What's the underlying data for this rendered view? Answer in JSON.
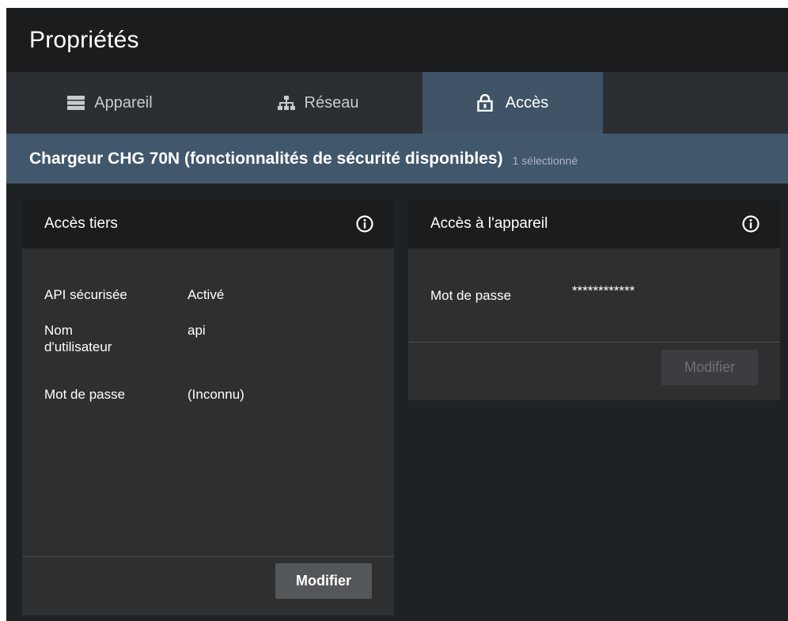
{
  "window": {
    "title": "Propriétés"
  },
  "tabs": [
    {
      "label": "Appareil",
      "icon": "server-icon",
      "active": false
    },
    {
      "label": "Réseau",
      "icon": "network-icon",
      "active": false
    },
    {
      "label": "Accès",
      "icon": "lock-icon",
      "active": true
    }
  ],
  "device": {
    "name": "Chargeur CHG 70N (fonctionnalités de sécurité disponibles)",
    "selection_count": "1 sélectionné"
  },
  "third_party_access": {
    "title": "Accès tiers",
    "rows": [
      {
        "label": "API sécurisée",
        "value": "Activé"
      },
      {
        "label": "Nom\nd'utilisateur",
        "value": "api"
      },
      {
        "label": "Mot de passe",
        "value": "(Inconnu)"
      }
    ],
    "button_label": "Modifier"
  },
  "device_access": {
    "title": "Accès à l'appareil",
    "rows": [
      {
        "label": "Mot de passe",
        "value": "************"
      }
    ],
    "button_label": "Modifier",
    "button_disabled": true
  },
  "colors": {
    "active_tab": "#3f5466",
    "device_header": "#41576b",
    "card_bg": "#2d2f31",
    "card_header_bg": "#1b1c1e"
  }
}
